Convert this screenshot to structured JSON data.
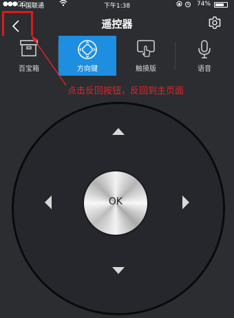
{
  "status_bar": {
    "signal": "●●●○○",
    "carrier": "中国联通",
    "wifi_icon": "wifi-icon",
    "time": "下午1:38",
    "battery": "74%",
    "battery_level": 0.74
  },
  "navbar": {
    "title": "遥控器",
    "back_icon": "chevron-left-icon",
    "settings_icon": "gear-icon"
  },
  "tabs": [
    {
      "label": "百宝箱",
      "icon": "box-icon",
      "active": false
    },
    {
      "label": "方向键",
      "icon": "dpad-icon",
      "active": true
    },
    {
      "label": "触摸版",
      "icon": "touchpad-icon",
      "active": false
    },
    {
      "label": "语音",
      "icon": "microphone-icon",
      "active": false
    }
  ],
  "annotation": {
    "text": "点击反回按钮，反回到主页面",
    "color": "#e8232a"
  },
  "dpad": {
    "ok_label": "OK"
  },
  "colors": {
    "background": "#2b2d31",
    "accent": "#1e8fe0",
    "highlight": "#e0191b"
  }
}
